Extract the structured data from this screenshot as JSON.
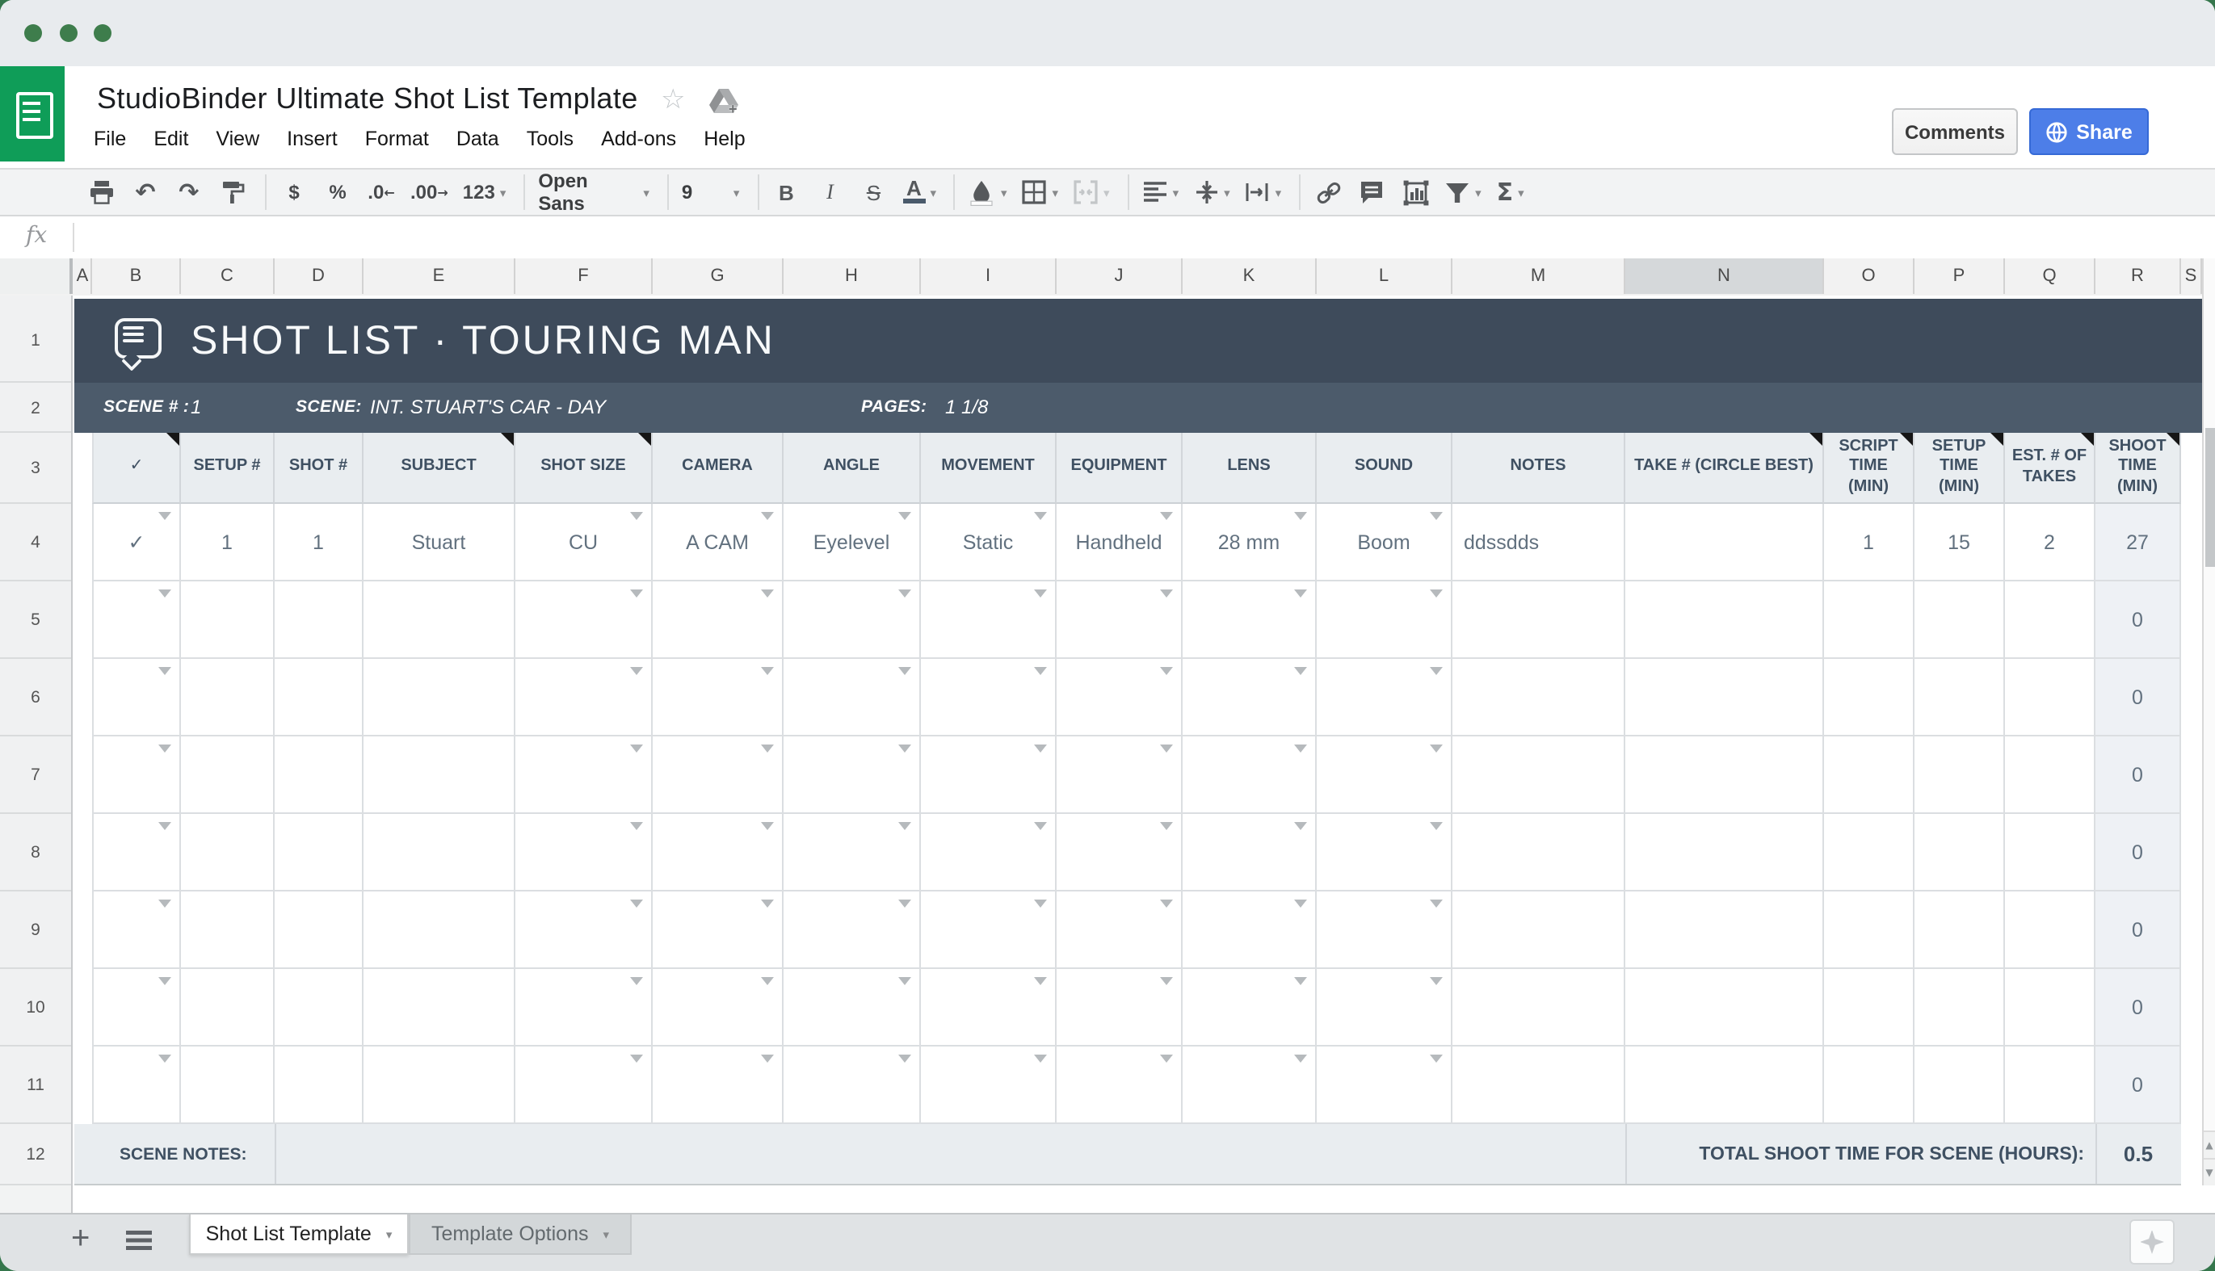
{
  "window": {
    "app": "Google Sheets"
  },
  "header": {
    "title": "StudioBinder Ultimate Shot List Template",
    "star_icon": "☆",
    "menus": [
      "File",
      "Edit",
      "View",
      "Insert",
      "Format",
      "Data",
      "Tools",
      "Add-ons",
      "Help"
    ]
  },
  "buttons": {
    "comments": "Comments",
    "share": "Share"
  },
  "toolbar": {
    "undo": "↶",
    "redo": "↷",
    "currency": "$",
    "percent": "%",
    "dec_less": ".0",
    "dec_more": ".00",
    "more_formats": "123",
    "font_name": "Open Sans",
    "font_size": "9",
    "bold": "B",
    "italic": "I",
    "strike": "S",
    "text_color": "A",
    "sum": "Σ",
    "caret": "▾",
    "arrow_left": "←",
    "arrow_right": "→"
  },
  "formula_bar": {
    "fx": "fx"
  },
  "grid": {
    "column_letters": [
      "A",
      "B",
      "C",
      "D",
      "E",
      "F",
      "G",
      "H",
      "I",
      "J",
      "K",
      "L",
      "M",
      "N",
      "O",
      "P",
      "Q",
      "R",
      "S"
    ],
    "selected_column": "N",
    "row_numbers": [
      "1",
      "2",
      "3",
      "4",
      "5",
      "6",
      "7",
      "8",
      "9",
      "10",
      "11",
      "12"
    ],
    "sheet_title": "SHOT LIST · TOURING MAN",
    "scene": {
      "scene_num_label": "SCENE # :",
      "scene_num": "1",
      "scene_label": "SCENE:",
      "scene_value": "INT. STUART'S CAR - DAY",
      "pages_label": "PAGES:",
      "pages_value": "1 1/8"
    },
    "columns": [
      {
        "col": "B",
        "label": "✓"
      },
      {
        "col": "C",
        "label": "SETUP #"
      },
      {
        "col": "D",
        "label": "SHOT #"
      },
      {
        "col": "E",
        "label": "SUBJECT"
      },
      {
        "col": "F",
        "label": "SHOT SIZE"
      },
      {
        "col": "G",
        "label": "CAMERA"
      },
      {
        "col": "H",
        "label": "ANGLE"
      },
      {
        "col": "I",
        "label": "MOVEMENT"
      },
      {
        "col": "J",
        "label": "EQUIPMENT"
      },
      {
        "col": "K",
        "label": "LENS"
      },
      {
        "col": "L",
        "label": "SOUND"
      },
      {
        "col": "M",
        "label": "NOTES"
      },
      {
        "col": "N",
        "label": "TAKE # (CIRCLE BEST)"
      },
      {
        "col": "O",
        "label": "SCRIPT TIME (MIN)"
      },
      {
        "col": "P",
        "label": "SETUP TIME (MIN)"
      },
      {
        "col": "Q",
        "label": "EST. # OF TAKES"
      },
      {
        "col": "R",
        "label": "SHOOT TIME (MIN)"
      }
    ],
    "note_markers": [
      "B",
      "E",
      "F",
      "N",
      "O",
      "P",
      "Q",
      "R"
    ],
    "dropdown_columns": [
      "B",
      "F",
      "G",
      "H",
      "I",
      "J",
      "K",
      "L"
    ],
    "rows": [
      {
        "B": "✓",
        "C": "1",
        "D": "1",
        "E": "Stuart",
        "F": "CU",
        "G": "A CAM",
        "H": "Eyelevel",
        "I": "Static",
        "J": "Handheld",
        "K": "28 mm",
        "L": "Boom",
        "M": "ddssdds",
        "N": "",
        "O": "1",
        "P": "15",
        "Q": "2",
        "R": "27"
      },
      {
        "R": "0"
      },
      {
        "R": "0"
      },
      {
        "R": "0"
      },
      {
        "R": "0"
      },
      {
        "R": "0"
      },
      {
        "R": "0"
      },
      {
        "R": "0"
      }
    ],
    "footer": {
      "scene_notes_label": "SCENE NOTES:",
      "total_label": "TOTAL SHOOT TIME FOR SCENE (HOURS):",
      "total_value": "0.5"
    }
  },
  "tabs": {
    "add": "+",
    "active": "Shot List Template",
    "inactive": "Template Options"
  },
  "colors": {
    "accent_green": "#0f9d58",
    "traffic_green": "#3e7d4c",
    "share_blue": "#4d7ee8",
    "header_dark": "#3e4b5b",
    "header_mid": "#4c5b6b",
    "header_light": "#e9edf0",
    "shoot_col_bg": "#eef1f5",
    "slate_text": "#3f5062",
    "cell_text": "#62717f"
  }
}
